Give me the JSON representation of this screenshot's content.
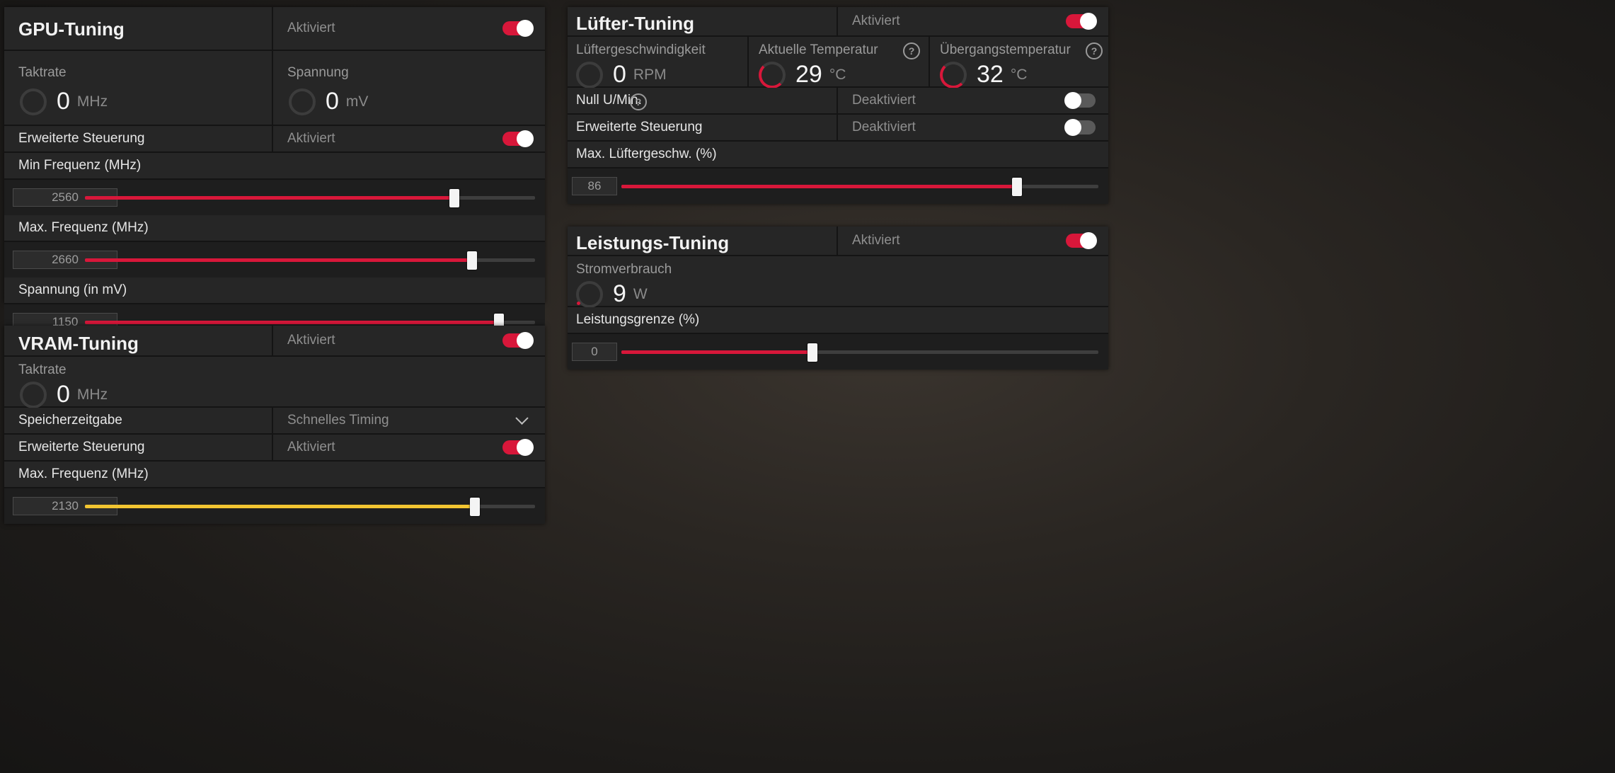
{
  "gpu": {
    "title": "GPU-Tuning",
    "state": "Aktiviert",
    "clock_cap": "Taktrate",
    "clock_val": "0",
    "clock_unit": "MHz",
    "volt_cap": "Spannung",
    "volt_val": "0",
    "volt_unit": "mV",
    "adv_label": "Erweiterte Steuerung",
    "adv_state": "Aktiviert",
    "min_label": "Min Frequenz (MHz)",
    "min_val": "2560",
    "min_fraction": 0.82,
    "max_label": "Max. Frequenz (MHz)",
    "max_val": "2660",
    "max_fraction": 0.86,
    "v_label": "Spannung (in mV)",
    "v_val": "1150",
    "v_fraction": 0.92
  },
  "vram": {
    "title": "VRAM-Tuning",
    "state": "Aktiviert",
    "clock_cap": "Taktrate",
    "clock_val": "0",
    "clock_unit": "MHz",
    "timing_label": "Speicherzeitgabe",
    "timing_val": "Schnelles Timing",
    "adv_label": "Erweiterte Steuerung",
    "adv_state": "Aktiviert",
    "max_label": "Max. Frequenz (MHz)",
    "max_val": "2130",
    "max_fraction": 0.866
  },
  "fan": {
    "title": "Lüfter-Tuning",
    "state": "Aktiviert",
    "speed_cap": "Lüftergeschwindigkeit",
    "speed_val": "0",
    "speed_unit": "RPM",
    "temp_cap": "Aktuelle Temperatur",
    "temp_val": "29",
    "temp_unit": "°C",
    "junction_cap": "Übergangstemperatur",
    "junction_val": "32",
    "junction_unit": "°C",
    "zero_label": "Null U/Min.",
    "zero_state": "Deaktiviert",
    "adv_label": "Erweiterte Steuerung",
    "adv_state": "Deaktiviert",
    "max_label": "Max. Lüftergeschw. (%)",
    "max_val": "86",
    "max_fraction": 0.83
  },
  "power": {
    "title": "Leistungs-Tuning",
    "state": "Aktiviert",
    "use_cap": "Stromverbrauch",
    "use_val": "9",
    "use_unit": "W",
    "limit_label": "Leistungsgrenze (%)",
    "limit_val": "0",
    "limit_fraction": 0.4
  },
  "help_glyph": "?",
  "icons": [
    "gauge-icon",
    "help-icon",
    "chevron-down-icon"
  ],
  "colors": {
    "accent": "#d8173a",
    "vram_fill": "#f2c531",
    "panel": "#262626"
  }
}
